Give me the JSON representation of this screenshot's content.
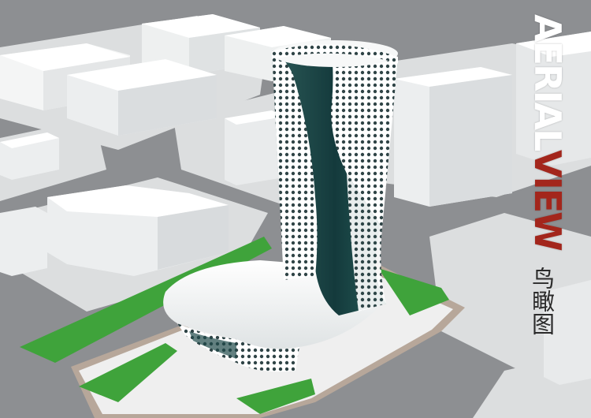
{
  "title": {
    "line_white": "AERIAL ",
    "line_red": "VIEW",
    "chinese": "鸟瞰图"
  },
  "colors": {
    "ground": "#8d8f92",
    "block": "#ffffff",
    "lawn": "#3fa33b",
    "facade": "#1f4a4a",
    "accent_red": "#a3261c"
  }
}
